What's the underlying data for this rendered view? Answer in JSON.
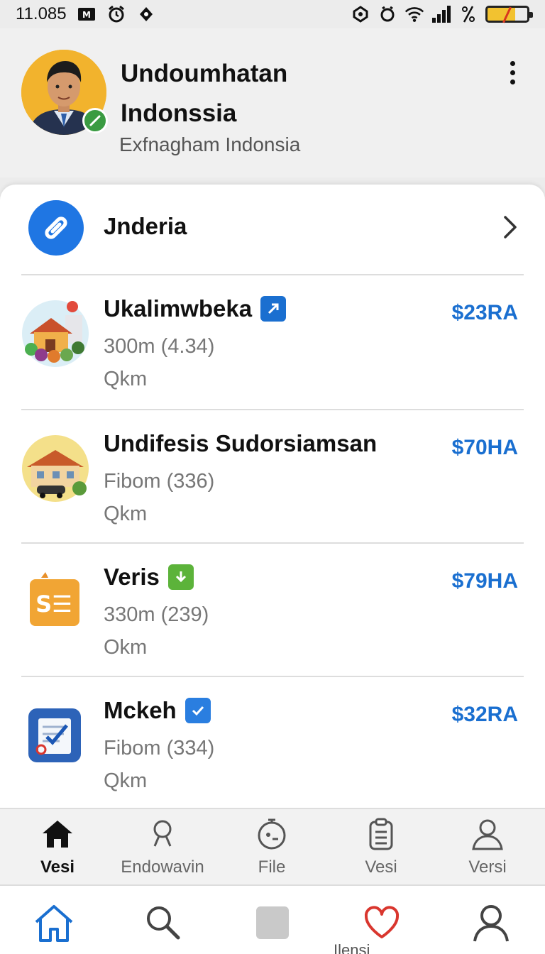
{
  "status_bar": {
    "time": "11.085",
    "icons": [
      "mi-icon",
      "alarm-icon",
      "location-icon",
      "nfc-icon",
      "clock-icon",
      "wifi-icon",
      "signal-icon",
      "data-icon",
      "battery-icon"
    ]
  },
  "profile": {
    "name": "Undoumhatan Indonssia",
    "subtitle": "Exfnagham Indonsia",
    "verified": true
  },
  "category": {
    "label": "Jnderia",
    "icon": "link-icon"
  },
  "items": [
    {
      "title": "Ukalimwbeka",
      "badge_icon": "link-badge-icon",
      "badge_color": "#1a6fd0",
      "meta": "300m (4.34)",
      "distance": "Qkm",
      "price": "$23RA"
    },
    {
      "title": "Undifesis Sudorsiamsan",
      "meta": "Fibom (336)",
      "distance": "Qkm",
      "price": "$70HA"
    },
    {
      "title": "Veris",
      "badge_icon": "download-badge-icon",
      "badge_color": "#5cb33a",
      "meta": "330m (239)",
      "distance": "Okm",
      "price": "$79HA"
    },
    {
      "title": "Mckeh",
      "badge_icon": "check-badge-icon",
      "badge_color": "#2a7ee0",
      "meta": "Fibom (334)",
      "distance": "Qkm",
      "price": "$32RA"
    }
  ],
  "tabs": [
    {
      "label": "Vesi",
      "icon": "home-icon",
      "active": true
    },
    {
      "label": "Endowavin",
      "icon": "search-icon"
    },
    {
      "label": "File",
      "icon": "timer-icon"
    },
    {
      "label": "Vesi",
      "icon": "clipboard-icon"
    },
    {
      "label": "Versi",
      "icon": "person-icon"
    }
  ],
  "bottom_nav": {
    "icons": [
      "home-outline-icon",
      "search-icon",
      "square-icon",
      "heart-icon",
      "profile-icon"
    ],
    "partial_label": "Ilensi",
    "accent": "#1a6fd0",
    "heart_color": "#d9362e"
  }
}
